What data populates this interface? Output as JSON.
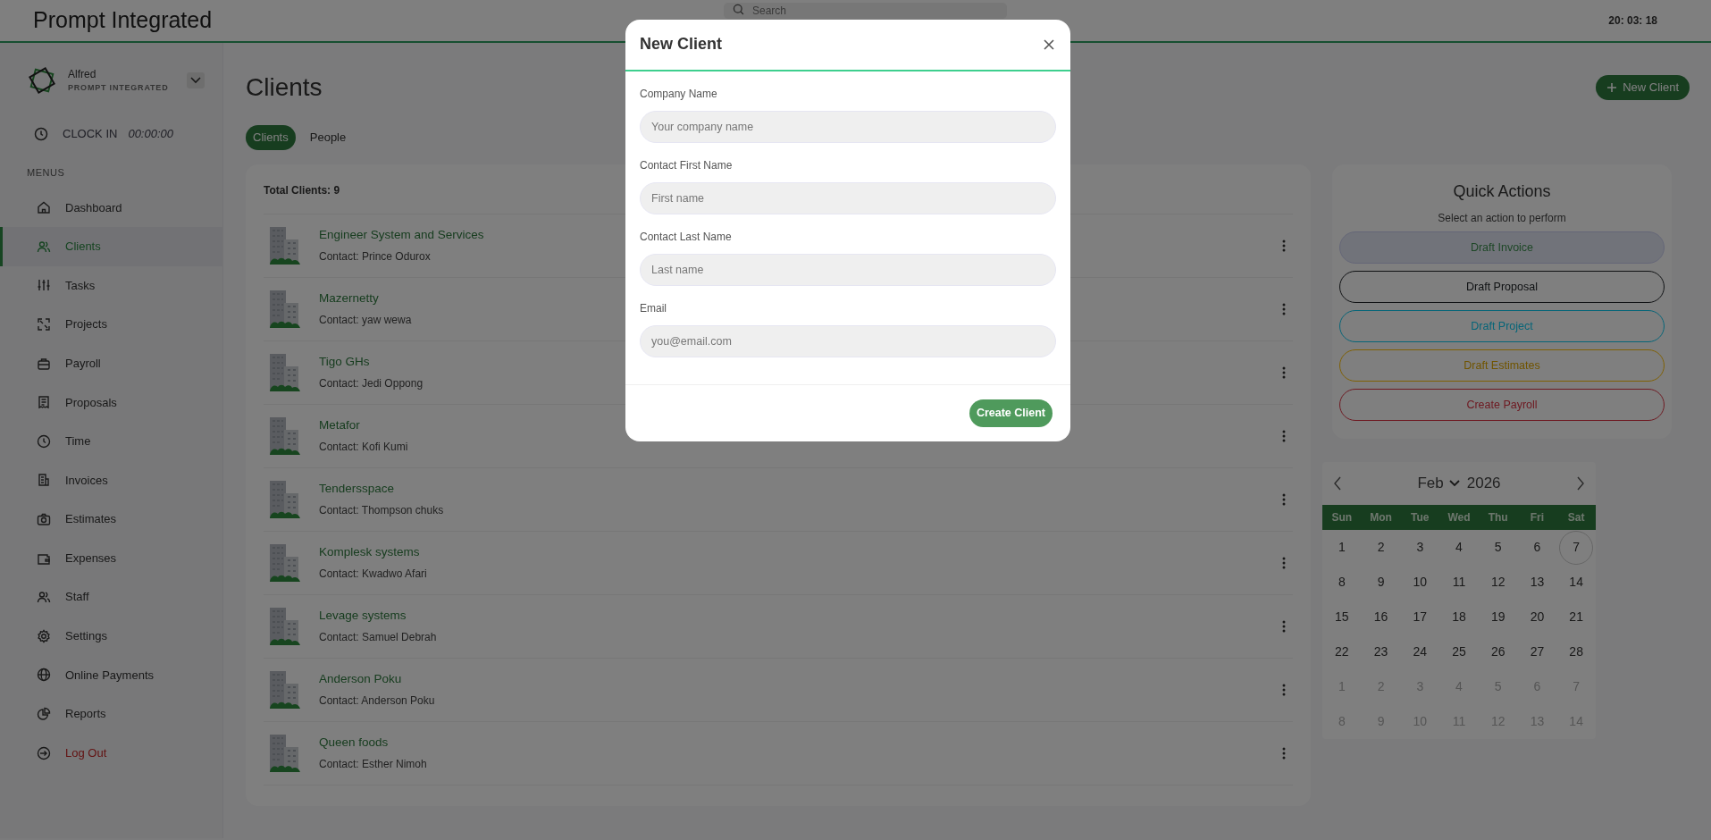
{
  "header": {
    "title": "Prompt Integrated",
    "search": {
      "placeholder": "Search"
    },
    "clock": "20: 03: 18"
  },
  "sidebar": {
    "user": {
      "name": "Alfred",
      "company": "PROMPT INTEGRATED"
    },
    "clock_in": {
      "label": "CLOCK IN",
      "time": "00:00:00"
    },
    "section": "MENUS",
    "items": [
      {
        "label": "Dashboard",
        "selected": false,
        "kind": "link"
      },
      {
        "label": "Clients",
        "selected": true,
        "kind": "link"
      },
      {
        "label": "Tasks",
        "selected": false,
        "kind": "link"
      },
      {
        "label": "Projects",
        "selected": false,
        "kind": "link"
      },
      {
        "label": "Payroll",
        "selected": false,
        "kind": "link"
      },
      {
        "label": "Proposals",
        "selected": false,
        "kind": "link"
      },
      {
        "label": "Time",
        "selected": false,
        "kind": "link"
      },
      {
        "label": "Invoices",
        "selected": false,
        "kind": "link"
      },
      {
        "label": "Estimates",
        "selected": false,
        "kind": "link"
      },
      {
        "label": "Expenses",
        "selected": false,
        "kind": "link"
      },
      {
        "label": "Staff",
        "selected": false,
        "kind": "link"
      },
      {
        "label": "Settings",
        "selected": false,
        "kind": "link"
      },
      {
        "label": "Online Payments",
        "selected": false,
        "kind": "link"
      },
      {
        "label": "Reports",
        "selected": false,
        "kind": "link"
      },
      {
        "label": "Log Out",
        "selected": false,
        "kind": "logout"
      }
    ]
  },
  "page": {
    "title": "Clients",
    "new_button": "New Client",
    "tabs": [
      {
        "label": "Clients",
        "selected": true
      },
      {
        "label": "People",
        "selected": false
      }
    ]
  },
  "client_list": {
    "total": "Total Clients: 9",
    "clients": [
      {
        "name": "Engineer System and Services",
        "contact": "Contact: Prince Odurox"
      },
      {
        "name": "Mazernetty",
        "contact": "Contact: yaw wewa"
      },
      {
        "name": "Tigo GHs",
        "contact": "Contact: Jedi Oppong"
      },
      {
        "name": "Metafor",
        "contact": "Contact: Kofi Kumi"
      },
      {
        "name": "Tendersspace",
        "contact": "Contact: Thompson chuks"
      },
      {
        "name": "Komplesk systems",
        "contact": "Contact: Kwadwo Afari"
      },
      {
        "name": "Levage systems",
        "contact": "Contact: Samuel Debrah"
      },
      {
        "name": "Anderson Poku",
        "contact": "Contact: Anderson Poku"
      },
      {
        "name": "Queen foods",
        "contact": "Contact: Esther Nimoh"
      }
    ]
  },
  "quick_actions": {
    "title": "Quick Actions",
    "subtitle": "Select an action to perform",
    "actions": [
      {
        "label": "Draft Invoice",
        "kind": "soft"
      },
      {
        "label": "Draft Proposal",
        "kind": "dark"
      },
      {
        "label": "Draft Project",
        "kind": "info"
      },
      {
        "label": "Draft Estimates",
        "kind": "warning"
      },
      {
        "label": "Create Payroll",
        "kind": "danger"
      }
    ]
  },
  "calendar": {
    "month": "Feb",
    "year": "2026",
    "weekdays": [
      "Sun",
      "Mon",
      "Tue",
      "Wed",
      "Thu",
      "Fri",
      "Sat"
    ],
    "weeks": [
      [
        {
          "label": "1",
          "muted": false,
          "today": false
        },
        {
          "label": "2",
          "muted": false,
          "today": false
        },
        {
          "label": "3",
          "muted": false,
          "today": false
        },
        {
          "label": "4",
          "muted": false,
          "today": false
        },
        {
          "label": "5",
          "muted": false,
          "today": false
        },
        {
          "label": "6",
          "muted": false,
          "today": false
        },
        {
          "label": "7",
          "muted": false,
          "today": true
        }
      ],
      [
        {
          "label": "8",
          "muted": false,
          "today": false
        },
        {
          "label": "9",
          "muted": false,
          "today": false
        },
        {
          "label": "10",
          "muted": false,
          "today": false
        },
        {
          "label": "11",
          "muted": false,
          "today": false
        },
        {
          "label": "12",
          "muted": false,
          "today": false
        },
        {
          "label": "13",
          "muted": false,
          "today": false
        },
        {
          "label": "14",
          "muted": false,
          "today": false
        }
      ],
      [
        {
          "label": "15",
          "muted": false,
          "today": false
        },
        {
          "label": "16",
          "muted": false,
          "today": false
        },
        {
          "label": "17",
          "muted": false,
          "today": false
        },
        {
          "label": "18",
          "muted": false,
          "today": false
        },
        {
          "label": "19",
          "muted": false,
          "today": false
        },
        {
          "label": "20",
          "muted": false,
          "today": false
        },
        {
          "label": "21",
          "muted": false,
          "today": false
        }
      ],
      [
        {
          "label": "22",
          "muted": false,
          "today": false
        },
        {
          "label": "23",
          "muted": false,
          "today": false
        },
        {
          "label": "24",
          "muted": false,
          "today": false
        },
        {
          "label": "25",
          "muted": false,
          "today": false
        },
        {
          "label": "26",
          "muted": false,
          "today": false
        },
        {
          "label": "27",
          "muted": false,
          "today": false
        },
        {
          "label": "28",
          "muted": false,
          "today": false
        }
      ],
      [
        {
          "label": "1",
          "muted": true,
          "today": false
        },
        {
          "label": "2",
          "muted": true,
          "today": false
        },
        {
          "label": "3",
          "muted": true,
          "today": false
        },
        {
          "label": "4",
          "muted": true,
          "today": false
        },
        {
          "label": "5",
          "muted": true,
          "today": false
        },
        {
          "label": "6",
          "muted": true,
          "today": false
        },
        {
          "label": "7",
          "muted": true,
          "today": false
        }
      ],
      [
        {
          "label": "8",
          "muted": true,
          "today": false
        },
        {
          "label": "9",
          "muted": true,
          "today": false
        },
        {
          "label": "10",
          "muted": true,
          "today": false
        },
        {
          "label": "11",
          "muted": true,
          "today": false
        },
        {
          "label": "12",
          "muted": true,
          "today": false
        },
        {
          "label": "13",
          "muted": true,
          "today": false
        },
        {
          "label": "14",
          "muted": true,
          "today": false
        }
      ]
    ]
  },
  "modal": {
    "title": "New Client",
    "fields": [
      {
        "label": "Company Name",
        "placeholder": "Your company name"
      },
      {
        "label": "Contact First Name",
        "placeholder": "First name"
      },
      {
        "label": "Contact Last Name",
        "placeholder": "Last name"
      },
      {
        "label": "Email",
        "placeholder": "you@email.com"
      }
    ],
    "submit": "Create Client"
  }
}
